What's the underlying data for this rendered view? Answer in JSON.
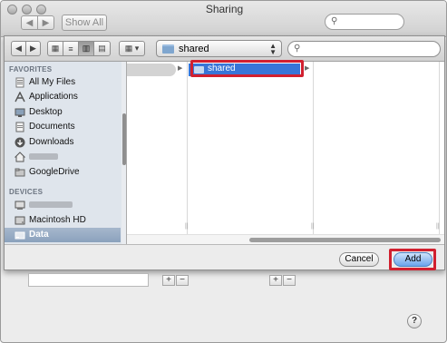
{
  "window": {
    "title": "Sharing",
    "show_all_label": "Show All",
    "search_placeholder": ""
  },
  "sheet": {
    "toolbar": {
      "back_glyph": "◀",
      "forward_glyph": "▶",
      "view_icon_glyph": "▦",
      "view_list_glyph": "≡",
      "view_columns_glyph": "▥",
      "view_flow_glyph": "▤",
      "arrange_glyph": "▦ ▾",
      "location": "shared",
      "search_placeholder": ""
    },
    "sidebar": {
      "favorites_header": "FAVORITES",
      "devices_header": "DEVICES",
      "favorites": [
        {
          "label": "All My Files",
          "icon": "all-files-icon"
        },
        {
          "label": "Applications",
          "icon": "applications-icon"
        },
        {
          "label": "Desktop",
          "icon": "desktop-icon"
        },
        {
          "label": "Documents",
          "icon": "documents-icon"
        },
        {
          "label": "Downloads",
          "icon": "downloads-icon"
        },
        {
          "label": "",
          "icon": "home-icon"
        },
        {
          "label": "GoogleDrive",
          "icon": "folder-icon"
        }
      ],
      "devices": [
        {
          "label": "",
          "icon": "computer-icon"
        },
        {
          "label": "Macintosh HD",
          "icon": "hard-disk-icon"
        },
        {
          "label": "Data",
          "icon": "external-disk-icon",
          "selected": true
        }
      ]
    },
    "browser": {
      "column2_selected": "shared",
      "arrow_glyph": "▶",
      "resize_glyph": "||"
    },
    "buttons": {
      "cancel": "Cancel",
      "add": "Add"
    }
  },
  "lower": {
    "plus": "+",
    "minus": "−",
    "help": "?"
  },
  "colors": {
    "selection_blue": "#3875d7",
    "highlight_red": "#d1202f",
    "sidebar_bg": "#dfe5ec"
  }
}
